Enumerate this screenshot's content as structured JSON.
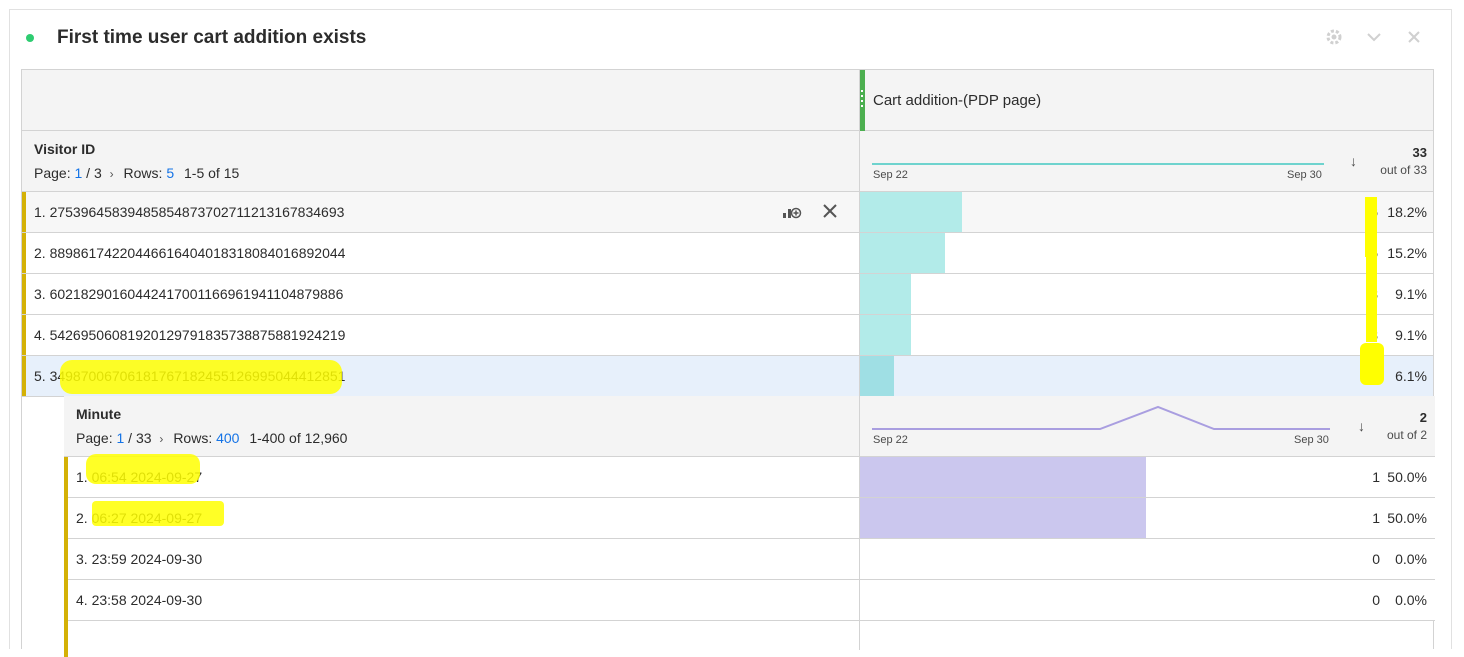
{
  "panel": {
    "title": "First time user cart addition exists"
  },
  "metric": {
    "name": "Cart addition-(PDP page)",
    "accent_color": "#4caf50"
  },
  "visitor": {
    "dimension": "Visitor ID",
    "page_label": "Page:",
    "page_current": "1",
    "page_total": "/ 3",
    "rows_label": "Rows:",
    "rows_value": "5",
    "range": "1-5 of 15",
    "spark_start": "Sep 22",
    "spark_end": "Sep 30",
    "total": "33",
    "out_of": "out of 33",
    "bar_color": "#b2ebe9",
    "rows": [
      {
        "label": "1.  27539645839485854873702711213167834693",
        "value": "6",
        "pct": "18.2%",
        "share": 0.182
      },
      {
        "label": "2.  88986174220446616404018318084016892044",
        "value": "5",
        "pct": "15.2%",
        "share": 0.152
      },
      {
        "label": "3.  60218290160442417001166961941104879886",
        "value": "3",
        "pct": "9.1%",
        "share": 0.091
      },
      {
        "label": "4.  54269506081920129791835738875881924219",
        "value": "3",
        "pct": "9.1%",
        "share": 0.091
      },
      {
        "label": "5.  34987006706181767182455126995044412851",
        "value": "2",
        "pct": "6.1%",
        "share": 0.061
      }
    ]
  },
  "minute": {
    "dimension": "Minute",
    "page_label": "Page:",
    "page_current": "1",
    "page_total": "/ 33",
    "rows_label": "Rows:",
    "rows_value": "400",
    "range": "1-400 of 12,960",
    "spark_start": "Sep 22",
    "spark_end": "Sep 30",
    "total": "2",
    "out_of": "out of 2",
    "bar_color": "#cbc7ee",
    "rows": [
      {
        "label": "1.  06:54 2024-09-27",
        "value": "1",
        "pct": "50.0%",
        "share": 0.5
      },
      {
        "label": "2.  06:27 2024-09-27",
        "value": "1",
        "pct": "50.0%",
        "share": 0.5
      },
      {
        "label": "3.  23:59 2024-09-30",
        "value": "0",
        "pct": "0.0%",
        "share": 0
      },
      {
        "label": "4.  23:58 2024-09-30",
        "value": "0",
        "pct": "0.0%",
        "share": 0
      }
    ]
  },
  "icons": {
    "settings": "gear-icon",
    "collapse": "chevron-down-icon",
    "close": "close-icon",
    "breakdown": "breakdown-icon",
    "remove": "close-icon",
    "sort": "sort-descending-icon"
  },
  "highlight_color": "#ffff00"
}
